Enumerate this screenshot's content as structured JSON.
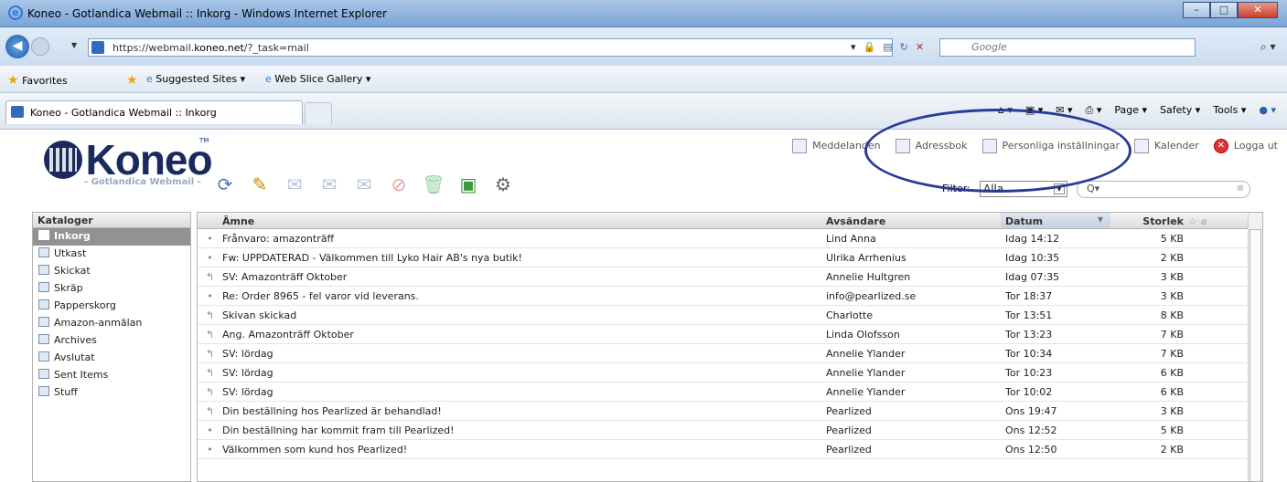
{
  "window": {
    "title": "Koneo - Gotlandica Webmail :: Inkorg - Windows Internet Explorer"
  },
  "address": {
    "url_prefix": "https://webmail.",
    "url_domain": "koneo.net",
    "url_path": "/?_task=mail",
    "search_placeholder": "Google"
  },
  "favbar": {
    "favorites": "Favorites",
    "suggested": "Suggested Sites ▾",
    "webslice": "Web Slice Gallery ▾"
  },
  "tab": {
    "label": "Koneo - Gotlandica Webmail :: Inkorg"
  },
  "cmdbar": {
    "page": "Page ▾",
    "safety": "Safety ▾",
    "tools": "Tools ▾"
  },
  "logo": {
    "word": "Koneo",
    "tm": "TM",
    "sub": "- Gotlandica Webmail -"
  },
  "topnav": {
    "messages": "Meddelanden",
    "addressbook": "Adressbok",
    "settings": "Personliga inställningar",
    "calendar": "Kalender",
    "logout": "Logga ut"
  },
  "filter": {
    "label": "Filter:",
    "value": "Alla",
    "search_placeholder": "Q▾"
  },
  "folders": {
    "header": "Kataloger",
    "items": [
      "Inkorg",
      "Utkast",
      "Skickat",
      "Skräp",
      "Papperskorg",
      "Amazon-anmälan",
      "Archives",
      "Avslutat",
      "Sent Items",
      "Stuff"
    ],
    "selected": "Inkorg"
  },
  "messages": {
    "columns": {
      "subject": "Ämne",
      "sender": "Avsändare",
      "date": "Datum",
      "size": "Storlek"
    },
    "rows": [
      {
        "icon": "•",
        "subject": "Frånvaro: amazonträff",
        "sender": "Lind Anna",
        "date": "Idag 14:12",
        "size": "5 KB"
      },
      {
        "icon": "•",
        "subject": "Fw: UPPDATERAD - Välkommen till Lyko Hair AB's nya butik!",
        "sender": "Ulrika Arrhenius",
        "date": "Idag 10:35",
        "size": "2 KB"
      },
      {
        "icon": "↰",
        "subject": "SV: Amazonträff Oktober",
        "sender": "Annelie Hultgren",
        "date": "Idag 07:35",
        "size": "3 KB"
      },
      {
        "icon": "•",
        "subject": "Re: Order 8965 - fel varor vid leverans.",
        "sender": "info@pearlized.se",
        "date": "Tor 18:37",
        "size": "3 KB"
      },
      {
        "icon": "↰",
        "subject": "Skivan skickad",
        "sender": "Charlotte",
        "date": "Tor 13:51",
        "size": "8 KB"
      },
      {
        "icon": "↰",
        "subject": "Ang. Amazonträff Oktober",
        "sender": "Linda Olofsson",
        "date": "Tor 13:23",
        "size": "7 KB"
      },
      {
        "icon": "↰",
        "subject": "SV: lördag",
        "sender": "Annelie Ylander",
        "date": "Tor 10:34",
        "size": "7 KB"
      },
      {
        "icon": "↰",
        "subject": "SV: lördag",
        "sender": "Annelie Ylander",
        "date": "Tor 10:23",
        "size": "6 KB"
      },
      {
        "icon": "↰",
        "subject": "SV: lördag",
        "sender": "Annelie Ylander",
        "date": "Tor 10:02",
        "size": "6 KB"
      },
      {
        "icon": "↰",
        "subject": "Din beställning hos Pearlized är behandlad!",
        "sender": "Pearlized",
        "date": "Ons 19:47",
        "size": "3 KB"
      },
      {
        "icon": "•",
        "subject": "Din beställning har kommit fram till Pearlized!",
        "sender": "Pearlized",
        "date": "Ons 12:52",
        "size": "5 KB"
      },
      {
        "icon": "•",
        "subject": "Välkommen som kund hos Pearlized!",
        "sender": "Pearlized",
        "date": "Ons 12:50",
        "size": "2 KB"
      }
    ]
  },
  "colors": {
    "brand": "#1a2a5e",
    "annotation": "#283a9a",
    "selected_folder": "#929292"
  }
}
